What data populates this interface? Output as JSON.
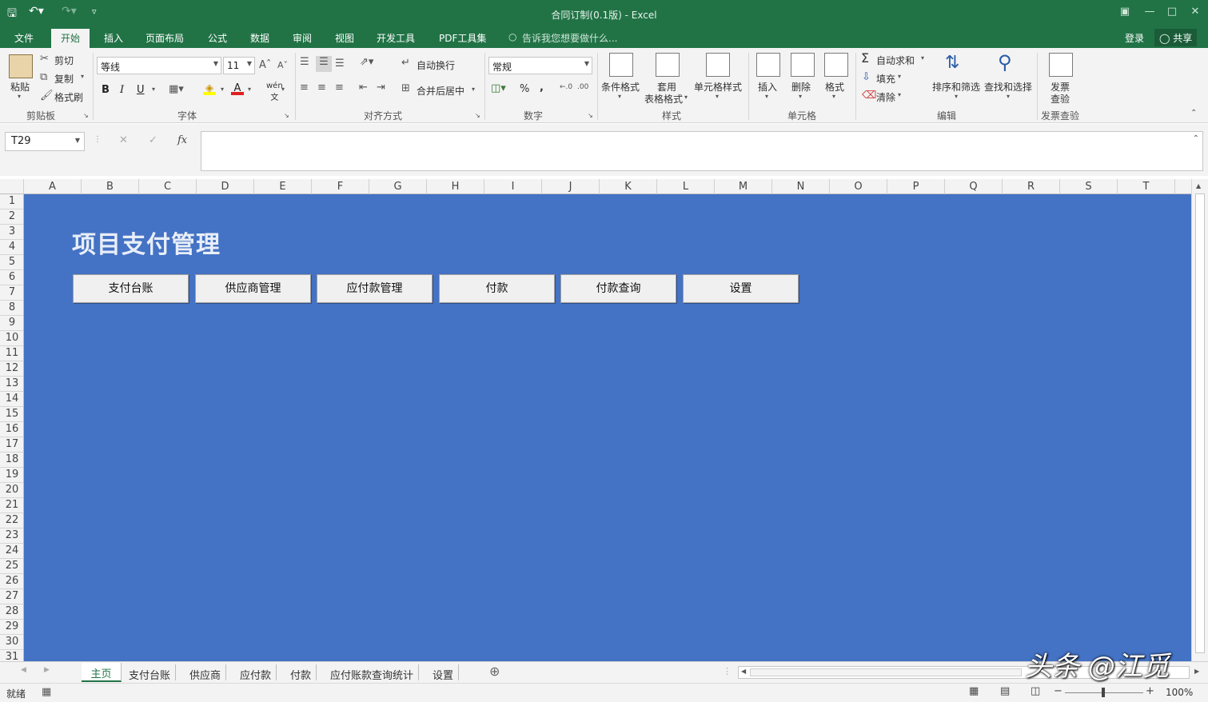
{
  "window": {
    "title": "合同订制(0.1版) - Excel",
    "signin": "登录",
    "share": "共享"
  },
  "ribbon_tabs": [
    "文件",
    "开始",
    "插入",
    "页面布局",
    "公式",
    "数据",
    "审阅",
    "视图",
    "开发工具",
    "PDF工具集"
  ],
  "tell_me": "告诉我您想要做什么...",
  "clipboard": {
    "paste": "粘贴",
    "cut": "剪切",
    "copy": "复制",
    "format_painter": "格式刷",
    "group": "剪贴板"
  },
  "font": {
    "name": "等线",
    "size": "11",
    "bold": "B",
    "italic": "I",
    "underline": "U",
    "group": "字体"
  },
  "alignment": {
    "wrap": "自动换行",
    "merge": "合并后居中",
    "group": "对齐方式"
  },
  "number": {
    "format": "常规",
    "percent": "%",
    "comma": ",",
    "group": "数字"
  },
  "styles": {
    "conditional": "条件格式",
    "table_1": "套用",
    "table_2": "表格格式",
    "cell_styles": "单元格样式",
    "group": "样式"
  },
  "cells": {
    "insert": "插入",
    "delete": "删除",
    "format": "格式",
    "group": "单元格"
  },
  "editing": {
    "autosum": "自动求和",
    "fill": "填充",
    "clear": "清除",
    "sort": "排序和筛选",
    "find": "查找和选择",
    "group": "编辑"
  },
  "invoice": {
    "check_1": "发票",
    "check_2": "查验",
    "group": "发票查验"
  },
  "formula_bar": {
    "name_box": "T29",
    "fx": "fx",
    "formula": ""
  },
  "columns": [
    "A",
    "B",
    "C",
    "D",
    "E",
    "F",
    "G",
    "H",
    "I",
    "J",
    "K",
    "L",
    "M",
    "N",
    "O",
    "P",
    "Q",
    "R",
    "S",
    "T"
  ],
  "rows": [
    "1",
    "2",
    "3",
    "4",
    "5",
    "6",
    "7",
    "8",
    "9",
    "10",
    "11",
    "12",
    "13",
    "14",
    "15",
    "16",
    "17",
    "18",
    "19",
    "20",
    "21",
    "22",
    "23",
    "24",
    "25",
    "26",
    "27",
    "28",
    "29",
    "30",
    "31"
  ],
  "sheet": {
    "title": "项目支付管理",
    "background_color": "#4472c4",
    "buttons": [
      "支付台账",
      "供应商管理",
      "应付款管理",
      "付款",
      "付款查询",
      "设置"
    ]
  },
  "sheet_tabs": [
    "主页",
    "支付台账",
    "供应商",
    "应付款",
    "付款",
    "应付账款查询统计",
    "设置"
  ],
  "active_sheet": "主页",
  "status": {
    "ready": "就绪",
    "zoom": "100%"
  },
  "watermark": "头条 @江觅",
  "accent_color": "#217346"
}
